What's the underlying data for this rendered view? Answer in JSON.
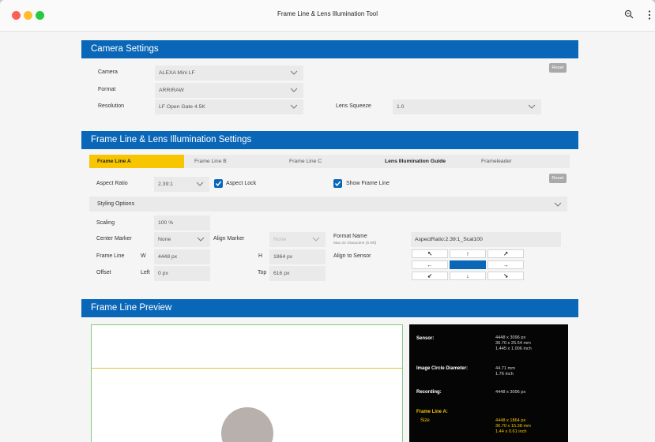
{
  "window": {
    "title": "Frame Line & Lens Illumination Tool"
  },
  "camera_settings": {
    "header": "Camera Settings",
    "reset_label": "Reset",
    "camera": {
      "label": "Camera",
      "value": "ALEXA Mini LF"
    },
    "format": {
      "label": "Format",
      "value": "ARRIRAW"
    },
    "resolution": {
      "label": "Resolution",
      "value": "LF Open Gate 4.5K"
    },
    "lens_squeeze": {
      "label": "Lens Squeeze",
      "value": "1.0"
    }
  },
  "frame_line_settings": {
    "header": "Frame Line & Lens Illumination Settings",
    "tabs": [
      {
        "label": "Frame Line A",
        "active": true
      },
      {
        "label": "Frame Line B"
      },
      {
        "label": "Frame Line C"
      },
      {
        "label": "Lens Illumination Guide"
      },
      {
        "label": "Frameleader"
      }
    ],
    "reset_label": "Reset",
    "aspect_ratio": {
      "label": "Aspect Ratio",
      "value": "2.39:1"
    },
    "aspect_lock": {
      "label": "Aspect Lock",
      "checked": true
    },
    "show_frame_line": {
      "label": "Show Frame Line",
      "checked": true
    },
    "styling_options": "Styling Options",
    "scaling": {
      "label": "Scaling",
      "value": "100 %"
    },
    "center_marker": {
      "label": "Center Marker",
      "value": "None"
    },
    "align_marker": {
      "label": "Align Marker",
      "value": "None"
    },
    "format_name": {
      "label": "Format Name",
      "hint": "Max 32 characters (6 left)",
      "value": "AspectRatio:2.39:1_Scal100"
    },
    "frame_line": {
      "label": "Frame Line",
      "w_label": "W",
      "w_value": "4448 px",
      "h_label": "H",
      "h_value": "1864 px"
    },
    "offset": {
      "label": "Offset",
      "left_label": "Left",
      "left_value": "0 px",
      "top_label": "Top",
      "top_value": "616 px"
    },
    "align_to_sensor": "Align to Sensor",
    "arrows": {
      "up_left": "↖",
      "up": "↑",
      "up_right": "↗",
      "left": "←",
      "center": "",
      "right": "→",
      "down_left": "↙",
      "down": "↓",
      "down_right": "↘"
    }
  },
  "preview": {
    "header": "Frame Line Preview",
    "sensor": {
      "label": "Sensor:",
      "lines": [
        "4448 x 3096 px",
        "36.70 x 25.54 mm",
        "1.445 x 1.006 inch"
      ]
    },
    "image_circle": {
      "label": "Image Circle Diameter:",
      "lines": [
        "44.71 mm",
        "1.76 inch"
      ]
    },
    "recording": {
      "label": "Recording:",
      "lines": [
        "4448 x 3096 px"
      ]
    },
    "frame_line_a": {
      "label": "Frame Line A:",
      "size_label": "Size",
      "lines": [
        "4448 x 1864 px",
        "36.70 x 15.38 mm",
        "1.44 x 0.61 inch"
      ]
    }
  },
  "colors": {
    "accent": "#0a67b8",
    "tab_active": "#f7c600",
    "frame_line": "#e4c33c",
    "preview_border": "#7fc97f"
  }
}
